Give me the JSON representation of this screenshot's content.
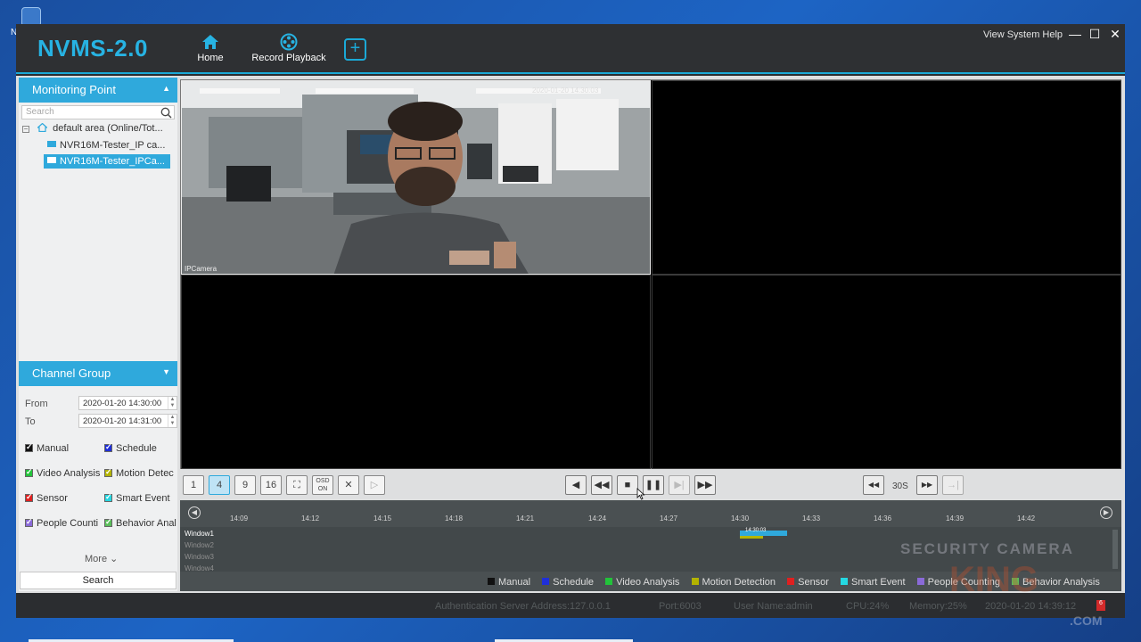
{
  "app": {
    "title": "NVMS-2.0",
    "nav": [
      {
        "label": "Home"
      },
      {
        "label": "Record Playback"
      }
    ],
    "add_tab_symbol": "+",
    "help": "View System Help",
    "window_controls": {
      "minimize": "—",
      "maximize": "☐",
      "close": "✕"
    }
  },
  "sidebar": {
    "monitoring_point": {
      "header": "Monitoring Point",
      "search_placeholder": "Search",
      "tree": {
        "root": "default area (Online/Tot...",
        "children": [
          {
            "label": "NVR16M-Tester_IP ca..."
          },
          {
            "label": "NVR16M-Tester_IPCa..."
          }
        ]
      }
    },
    "channel_group": {
      "header": "Channel Group"
    },
    "time_range": {
      "from_label": "From",
      "from_value": "2020-01-20 14:30:00",
      "to_label": "To",
      "to_value": "2020-01-20 14:31:00"
    },
    "event_types": [
      {
        "label": "Manual",
        "color": "#111111"
      },
      {
        "label": "Schedule",
        "color": "#1f2fd8"
      },
      {
        "label": "Video Analysis",
        "color": "#22c33a"
      },
      {
        "label": "Motion Detec",
        "color": "#b3b300"
      },
      {
        "label": "Sensor",
        "color": "#e02020"
      },
      {
        "label": "Smart Event",
        "color": "#24d8e2"
      },
      {
        "label": "People Counti",
        "color": "#8a6ad8"
      },
      {
        "label": "Behavior Anal",
        "color": "#5bbf5b"
      }
    ],
    "more_label": "More",
    "search_button": "Search"
  },
  "video": {
    "tile1": {
      "camera_label": "IPCamera",
      "osd": "2020-01-20 14:30:03"
    }
  },
  "controls": {
    "layout_buttons": [
      "1",
      "4",
      "9",
      "16",
      "⛶",
      "OSD ON",
      "✕",
      "▷"
    ],
    "speed_label": "30S"
  },
  "timeline": {
    "ticks": [
      "14:09",
      "14:12",
      "14:15",
      "14:18",
      "14:21",
      "14:24",
      "14:27",
      "14:30",
      "14:33",
      "14:36",
      "14:39",
      "14:42"
    ],
    "windows": [
      "Window1",
      "Window2",
      "Window3",
      "Window4"
    ],
    "record_label": "14:30:03",
    "legend": [
      {
        "label": "Manual",
        "color": "#111111"
      },
      {
        "label": "Schedule",
        "color": "#1f2fd8"
      },
      {
        "label": "Video Analysis",
        "color": "#22c33a"
      },
      {
        "label": "Motion Detection",
        "color": "#b3b300"
      },
      {
        "label": "Sensor",
        "color": "#e02020"
      },
      {
        "label": "Smart Event",
        "color": "#24d8e2"
      },
      {
        "label": "People Counting",
        "color": "#8a6ad8"
      },
      {
        "label": "Behavior Analysis",
        "color": "#5bbf5b"
      }
    ]
  },
  "status": {
    "auth_server": "Authentication Server Address:127.0.0.1",
    "port": "Port:6003",
    "user": "User Name:admin",
    "cpu": "CPU:24%",
    "memory": "Memory:25%",
    "datetime": "2020-01-20 14:39:12",
    "alarm_count": "6"
  },
  "watermark": {
    "line1": "SECURITY CAMERA",
    "line2": "KING",
    "line3": ".COM"
  }
}
